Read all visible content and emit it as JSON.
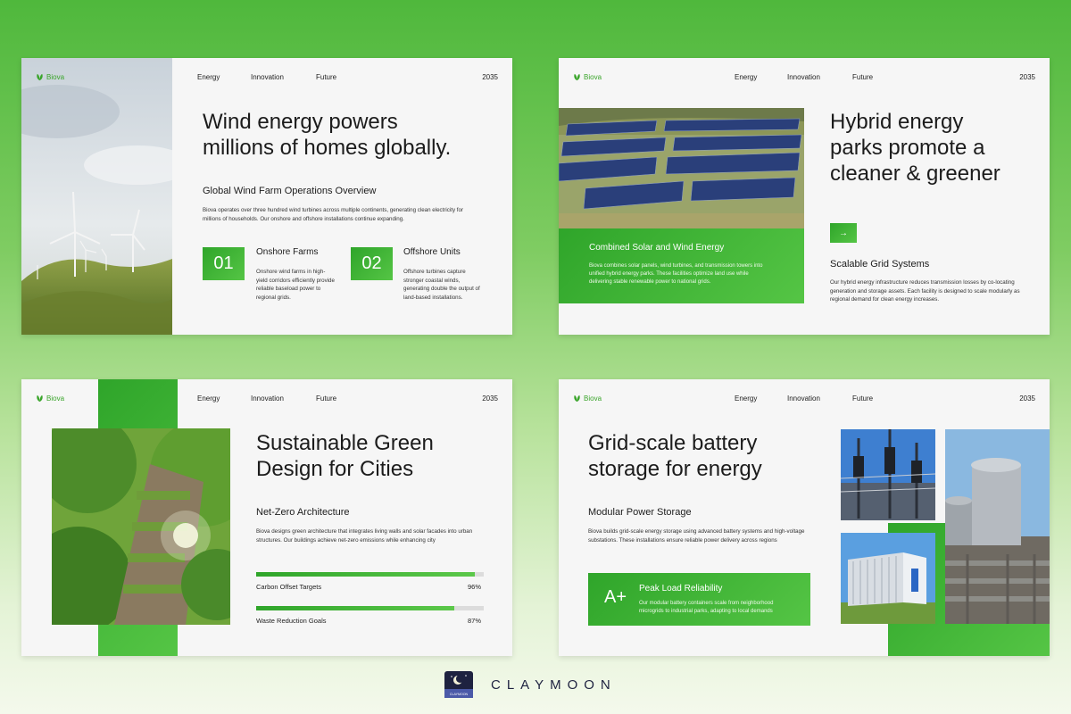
{
  "common": {
    "brand": "Biova",
    "nav": [
      "Energy",
      "Innovation",
      "Future"
    ],
    "year": "2035"
  },
  "slide1": {
    "title_line1": "Wind energy powers",
    "title_line2": "millions of homes globally.",
    "subtitle": "Global Wind Farm Operations Overview",
    "body": "Biova operates over three hundred wind turbines across multiple continents, generating clean electricity for millions of households. Our onshore and offshore installations continue expanding.",
    "items": [
      {
        "num": "01",
        "title": "Onshore Farms",
        "text": "Onshore wind farms in high-yield corridors efficiently provide reliable baseload power to regional grids."
      },
      {
        "num": "02",
        "title": "Offshore Units",
        "text": "Offshore turbines capture stronger coastal winds, generating double the output of land-based installations."
      }
    ]
  },
  "slide2": {
    "title_line1": "Hybrid energy",
    "title_line2": "parks promote a",
    "title_line3": "cleaner & greener",
    "card_title": "Combined Solar and Wind Energy",
    "card_text": "Biova combines solar panels, wind turbines, and transmission towers into unified hybrid energy parks. These facilities optimize land use while delivering stable renewable power to national grids.",
    "arrow": "→",
    "subtitle": "Scalable Grid Systems",
    "body": "Our hybrid energy infrastructure reduces transmission losses by co-locating generation and storage assets. Each facility is designed to scale modularly as regional demand for clean energy increases."
  },
  "slide3": {
    "title_line1": "Sustainable Green",
    "title_line2": "Design for Cities",
    "subtitle": "Net-Zero Architecture",
    "body": "Biova designs green architecture that integrates living walls and solar facades into urban structures. Our buildings achieve net-zero emissions while enhancing city",
    "progress": [
      {
        "label": "Carbon Offset Targets",
        "value_text": "96%",
        "value": 0.96
      },
      {
        "label": "Waste Reduction Goals",
        "value_text": "87%",
        "value": 0.87
      }
    ]
  },
  "slide4": {
    "title_line1": "Grid-scale battery",
    "title_line2": "storage for energy",
    "subtitle": "Modular Power Storage",
    "body": "Biova builds grid-scale energy storage using advanced battery systems and high-voltage substations. These installations ensure reliable power delivery across regions",
    "card_grade": "A+",
    "card_title": "Peak Load Reliability",
    "card_text": "Our modular battery containers scale from neighborhood microgrids to industrial parks, adapting to local demands"
  },
  "footer": {
    "wordmark": "CLAYMOON",
    "logo_text": "CLAYMOON"
  },
  "colors": {
    "accent": "#3aa52b",
    "accent_light": "#55c545",
    "navy": "#1e2240"
  }
}
